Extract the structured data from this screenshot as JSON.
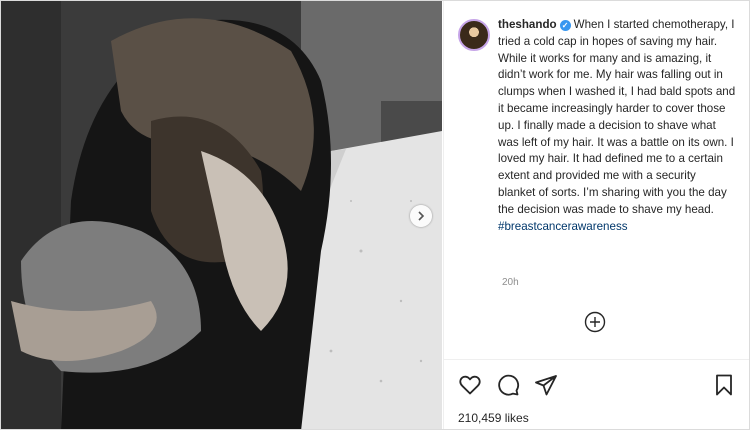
{
  "post": {
    "username": "theshando",
    "caption": "When I started chemotherapy, I tried a cold cap in hopes of saving my hair. While it works for many and is amazing, it didn’t work for me. My hair was falling out in clumps when I washed it, I had bald spots and it became increasingly harder to cover those up. I finally made a decision to shave what was left of my hair. It was a battle on its own. I loved my hair. It had defined me to a certain extent and provided me with a security blanket of sorts. I’m sharing with you the day the decision was made to shave my head.",
    "hashtag": "#breastcancerawareness",
    "timestamp": "20h",
    "likes": "210,459 likes"
  },
  "icons": {
    "verified": "verified-badge-icon",
    "carousel_next": "chevron-right-icon",
    "add_comment": "plus-circle-icon",
    "like": "heart-icon",
    "comment": "comment-icon",
    "share": "paper-plane-icon",
    "save": "bookmark-icon"
  },
  "colors": {
    "accent": "#3897f0",
    "hashtag": "#00376b",
    "text": "#262626",
    "muted": "#8e8e8e"
  }
}
